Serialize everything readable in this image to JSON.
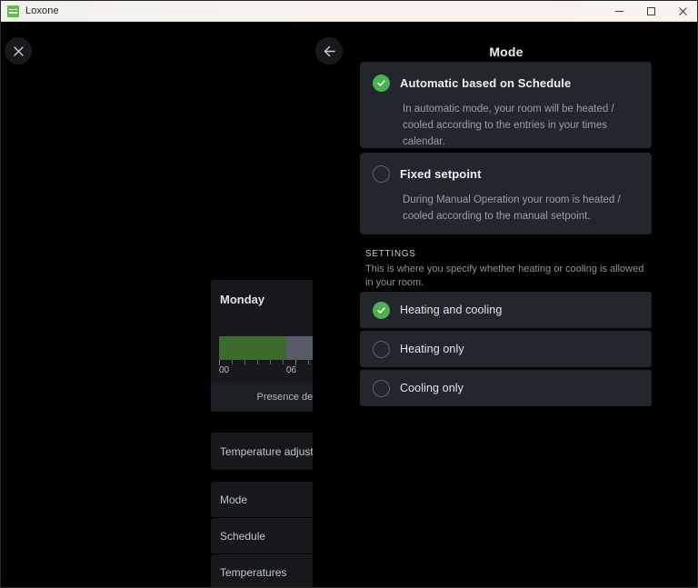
{
  "window": {
    "app_title": "Loxone",
    "logo_icon": "loxone-logo-icon",
    "controls": {
      "minimize": "minimize-icon",
      "maximize": "maximize-icon",
      "close": "close-icon"
    },
    "accent_green": "#4caf50",
    "card_bg": "#22262d",
    "page_bg": "#000000"
  },
  "header": {
    "close_label": "close-overlay",
    "back_label": "back",
    "title": "Mode"
  },
  "background_panel": {
    "schedule_widget": {
      "day": "Monday",
      "axis_labels": [
        "00",
        "06"
      ],
      "fill_percent": 66,
      "fill_color": "#3d6b2e",
      "track_color": "#565d68",
      "presence_label": "Presence detect"
    },
    "items": [
      {
        "label": "Temperature adjust"
      },
      {
        "label": "Mode"
      },
      {
        "label": "Schedule"
      },
      {
        "label": "Temperatures"
      }
    ]
  },
  "mode_options": [
    {
      "title": "Automatic based on Schedule",
      "description": "In automatic mode, your room will be heated / cooled according to the entries in your times calendar.",
      "selected": true
    },
    {
      "title": "Fixed setpoint",
      "description": "During Manual Operation your room is heated / cooled according to the manual setpoint.",
      "selected": false
    }
  ],
  "settings": {
    "section_title": "SETTINGS",
    "section_description": "This is where you specify whether heating or cooling is allowed in your room.",
    "options": [
      {
        "label": "Heating and cooling",
        "selected": true
      },
      {
        "label": "Heating only",
        "selected": false
      },
      {
        "label": "Cooling only",
        "selected": false
      }
    ]
  }
}
